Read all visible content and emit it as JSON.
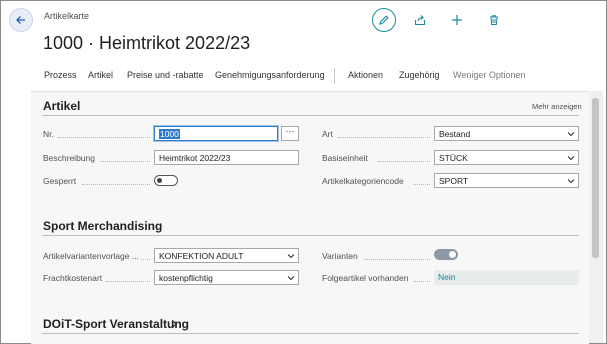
{
  "header": {
    "breadcrumb": "Artikelkarte",
    "title": "1000 · Heimtrikot 2022/23"
  },
  "actions": {
    "items": [
      "Prozess",
      "Artikel",
      "Preise und -rabatte",
      "Genehmigungsanforderung",
      "Aktionen",
      "Zugehörig",
      "Weniger Optionen"
    ]
  },
  "artikel": {
    "title": "Artikel",
    "show_more": "Mehr anzeigen",
    "nr_label": "Nr.",
    "nr_value": "1000",
    "nr_more": "···",
    "beschreibung_label": "Beschreibung",
    "beschreibung_value": "Heimtrikot 2022/23",
    "gesperrt_label": "Gesperrt",
    "gesperrt_state": "off",
    "art_label": "Art",
    "art_value": "Bestand",
    "basiseinheit_label": "Basiseinheit",
    "basiseinheit_value": "STÜCK",
    "kategorie_label": "Artikelkategoriencode",
    "kategorie_value": "SPORT"
  },
  "sport": {
    "title": "Sport Merchandising",
    "variantenvorlage_label": "Artikelvariantenvorlage ...",
    "variantenvorlage_value": "KONFEKTION ADULT",
    "frachtkostenart_label": "Frachtkostenart",
    "frachtkostenart_value": "kostenpflichtig",
    "varianten_label": "Varianten",
    "varianten_state": "on",
    "folgeartikel_label": "Folgeartikel vorhanden",
    "folgeartikel_value": "Nein"
  },
  "doit": {
    "title": "DOiT-Sport Veranstaltung"
  },
  "icons": {
    "back": "back-arrow-icon",
    "edit": "pencil-icon",
    "share": "share-icon",
    "new": "plus-icon",
    "delete": "trash-icon"
  },
  "colors": {
    "accent": "#1a8ba0",
    "selection": "#2f7bd0",
    "readonly_text": "#1a7f8e"
  }
}
